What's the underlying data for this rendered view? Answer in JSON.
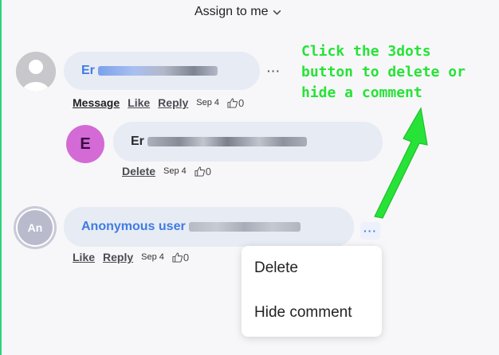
{
  "header": {
    "assign_label": "Assign to me"
  },
  "comments": [
    {
      "author_initial": "",
      "name_visible": "Er",
      "actions": [
        "Message",
        "Like",
        "Reply"
      ],
      "timestamp": "Sep 4",
      "likes": "0"
    },
    {
      "author_initial": "E",
      "name_visible": "Er",
      "actions": [
        "Delete"
      ],
      "timestamp": "Sep 4",
      "likes": "0"
    },
    {
      "author_initial": "An",
      "name_visible": "Anonymous user",
      "actions": [
        "Like",
        "Reply"
      ],
      "timestamp": "Sep 4",
      "likes": "0"
    }
  ],
  "more_button_label": "···",
  "context_menu": {
    "items": [
      "Delete",
      "Hide comment"
    ]
  },
  "annotation": {
    "text": "Click the 3dots\nbutton to delete or\nhide a comment",
    "color": "#27e337"
  },
  "colors": {
    "accent": "#3f7be6",
    "bubble": "#e7ebf3",
    "avatar_e": "#d36ad6"
  }
}
